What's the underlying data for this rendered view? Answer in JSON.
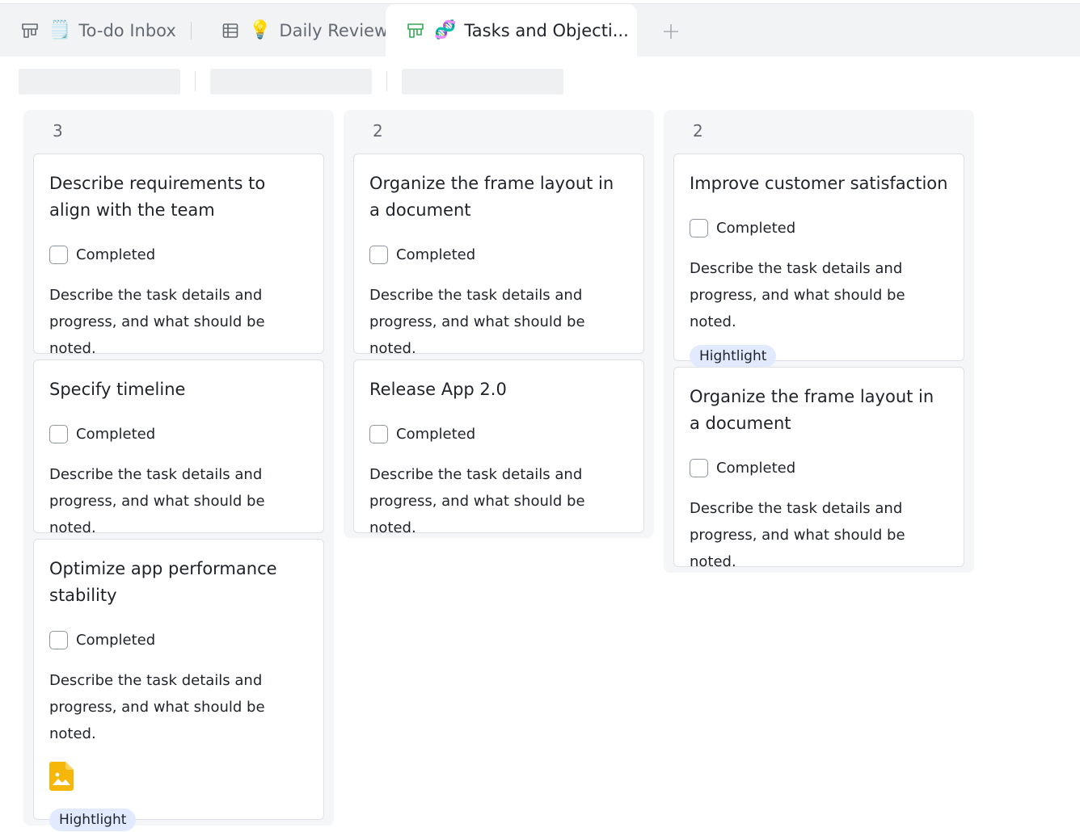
{
  "tabs": [
    {
      "label": "To-do Inbox",
      "emoji": "🗒️",
      "view_icon": "kanban-icon",
      "active": false
    },
    {
      "label": "Daily Review",
      "emoji": "💡",
      "view_icon": "grid-table-icon",
      "active": false
    },
    {
      "label": "Tasks and Objecti...",
      "emoji": "🧬",
      "view_icon": "kanban-icon",
      "active": true
    }
  ],
  "add_tab_icon": "plus-icon",
  "colors": {
    "active_tab_icon": "#34a853",
    "tag_bg": "#e1eaff",
    "image_icon": "#f5b70a"
  },
  "columns": [
    {
      "count": "3",
      "cards": [
        {
          "title": "Describe requirements to align with the team",
          "check_label": "Completed",
          "desc": "Describe the task details and progress, and what should be noted."
        },
        {
          "title": "Specify timeline",
          "check_label": "Completed",
          "desc": "Describe the task details and progress, and what should be noted."
        },
        {
          "title": "Optimize app performance stability",
          "check_label": "Completed",
          "desc": "Describe the task details and progress, and what should be noted.",
          "attachment_icon": "image-file-icon",
          "tag": "Hightlight"
        }
      ]
    },
    {
      "count": "2",
      "cards": [
        {
          "title": "Organize the frame layout in a document",
          "check_label": "Completed",
          "desc": "Describe the task details and progress, and what should be noted."
        },
        {
          "title": "Release App 2.0",
          "check_label": "Completed",
          "desc": "Describe the task details and progress, and what should be noted."
        }
      ]
    },
    {
      "count": "2",
      "cards": [
        {
          "title": "Improve customer satisfaction",
          "check_label": "Completed",
          "desc": "Describe the task details and progress, and what should be noted.",
          "tag": "Hightlight"
        },
        {
          "title": "Organize the frame layout in a document",
          "check_label": "Completed",
          "desc": "Describe the task details and progress, and what should be noted."
        }
      ]
    }
  ]
}
